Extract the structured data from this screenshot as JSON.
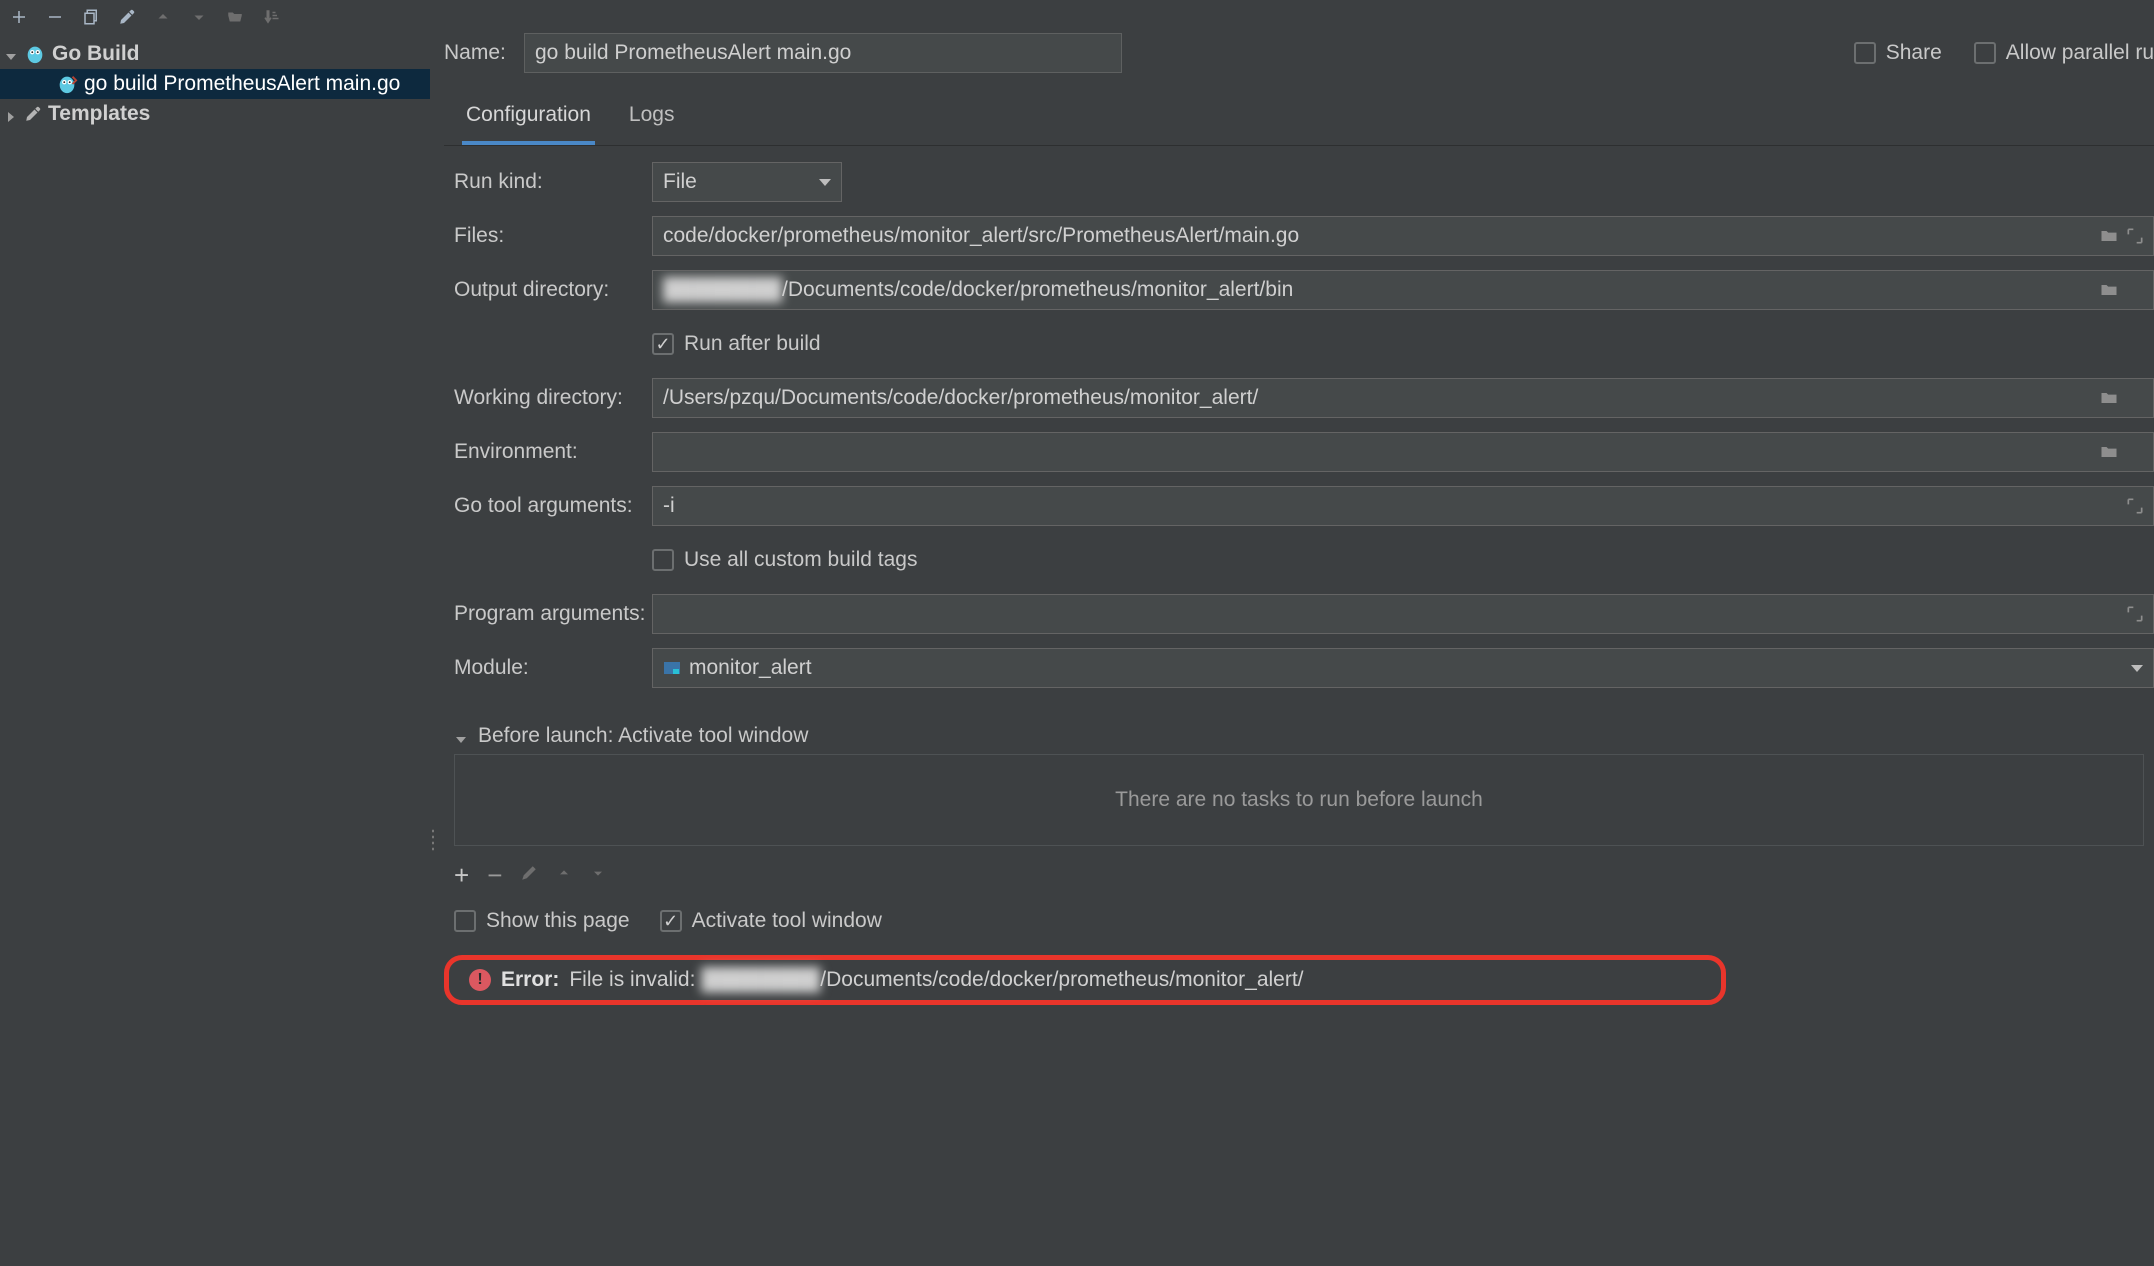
{
  "toolbar_icons": [
    "add-icon",
    "remove-icon",
    "copy-icon",
    "settings-icon",
    "move-up-icon",
    "move-down-icon",
    "folder-open-icon",
    "sort-icon"
  ],
  "tree": {
    "root": {
      "label": "Go Build"
    },
    "child": {
      "label": "go build PrometheusAlert main.go"
    },
    "templates": {
      "label": "Templates"
    }
  },
  "header": {
    "name_label": "Name:",
    "name_value": "go build PrometheusAlert main.go",
    "share_label": "Share",
    "allow_parallel_label": "Allow parallel ru"
  },
  "tabs": {
    "configuration": "Configuration",
    "logs": "Logs"
  },
  "form": {
    "run_kind_label": "Run kind:",
    "run_kind_value": "File",
    "files_label": "Files:",
    "files_value": "code/docker/prometheus/monitor_alert/src/PrometheusAlert/main.go",
    "output_dir_label": "Output directory:",
    "output_dir_redacted": "████████",
    "output_dir_tail": "/Documents/code/docker/prometheus/monitor_alert/bin",
    "run_after_build_label": "Run after build",
    "working_dir_label": "Working directory:",
    "working_dir_value": "/Users/pzqu/Documents/code/docker/prometheus/monitor_alert/",
    "environment_label": "Environment:",
    "environment_value": "",
    "go_tool_args_label": "Go tool arguments:",
    "go_tool_args_value": "-i",
    "use_all_tags_label": "Use all custom build tags",
    "program_args_label": "Program arguments:",
    "program_args_value": "",
    "module_label": "Module:",
    "module_value": "monitor_alert"
  },
  "before_launch": {
    "header": "Before launch: Activate tool window",
    "empty": "There are no tasks to run before launch",
    "show_this_page": "Show this page",
    "activate_tool_window": "Activate tool window"
  },
  "error": {
    "label": "Error:",
    "text_head": "File is invalid: ",
    "redacted": "████████",
    "text_tail": "/Documents/code/docker/prometheus/monitor_alert/"
  }
}
